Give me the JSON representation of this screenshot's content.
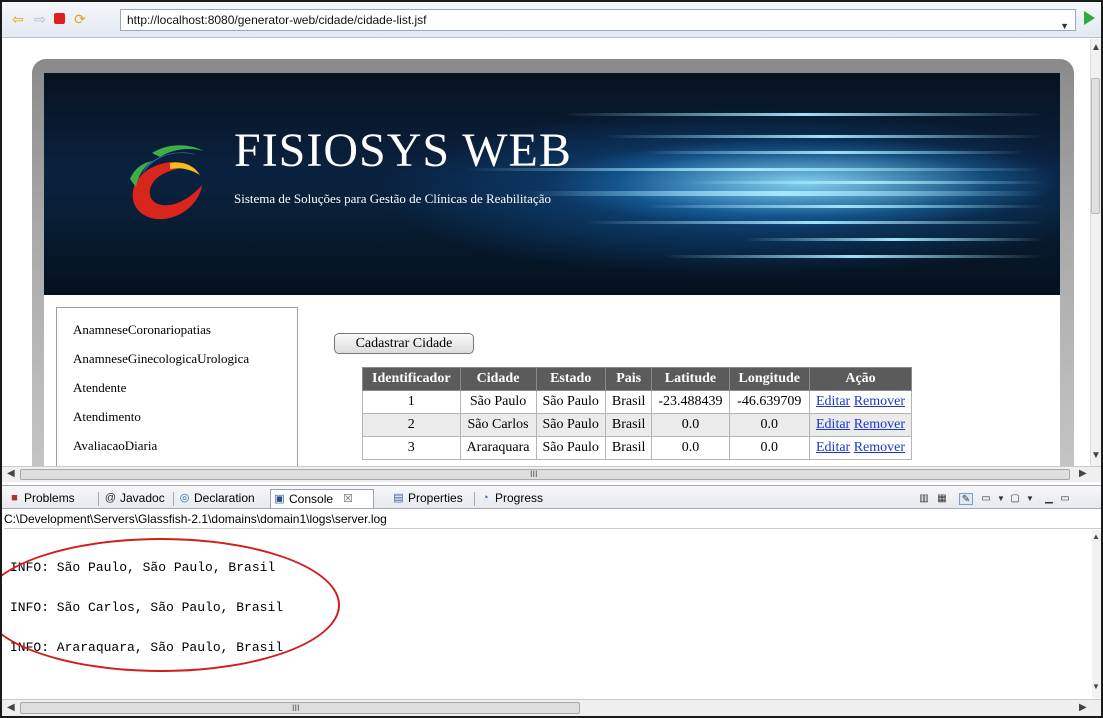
{
  "browser": {
    "url": "http://localhost:8080/generator-web/cidade/cidade-list.jsf",
    "dropdown_glyph": "▼"
  },
  "banner": {
    "title": "FISIOSYS WEB",
    "subtitle": "Sistema de Soluções para Gestão de Clínicas de Reabilitação"
  },
  "sidebar": {
    "items": [
      "AnamneseCoronariopatias",
      "AnamneseGinecologicaUrologica",
      "Atendente",
      "Atendimento",
      "AvaliacaoDiaria"
    ]
  },
  "content": {
    "cadastrar_label": "Cadastrar Cidade",
    "table": {
      "headers": [
        "Identificador",
        "Cidade",
        "Estado",
        "Pais",
        "Latitude",
        "Longitude",
        "Ação"
      ],
      "rows": [
        {
          "id": "1",
          "cidade": "São Paulo",
          "estado": "São Paulo",
          "pais": "Brasil",
          "latitude": "-23.488439",
          "longitude": "-46.639709"
        },
        {
          "id": "2",
          "cidade": "São Carlos",
          "estado": "São Paulo",
          "pais": "Brasil",
          "latitude": "0.0",
          "longitude": "0.0"
        },
        {
          "id": "3",
          "cidade": "Araraquara",
          "estado": "São Paulo",
          "pais": "Brasil",
          "latitude": "0.0",
          "longitude": "0.0"
        }
      ],
      "editar_label": "Editar",
      "remover_label": "Remover"
    }
  },
  "views": {
    "tabs": [
      {
        "label": "Problems",
        "icon": "problems-icon"
      },
      {
        "label": "Javadoc",
        "icon": "javadoc-icon"
      },
      {
        "label": "Declaration",
        "icon": "declaration-icon"
      },
      {
        "label": "Console",
        "icon": "console-icon"
      },
      {
        "label": "Properties",
        "icon": "properties-icon"
      },
      {
        "label": "Progress",
        "icon": "progress-icon"
      }
    ],
    "console_close_glyph": "☒",
    "javadoc_glyph": "@"
  },
  "console": {
    "path": "C:\\Development\\Servers\\Glassfish-2.1\\domains\\domain1\\logs\\server.log",
    "lines": [
      "INFO: São Paulo, São Paulo, Brasil",
      "INFO: São Carlos, São Paulo, Brasil",
      "INFO: Araraquara, São Paulo, Brasil"
    ]
  },
  "scrollbar": {
    "grip": "III"
  },
  "colors": {
    "table_header": "#5b5b5b",
    "link": "#1a37c9",
    "annotation": "#d21d1d"
  }
}
